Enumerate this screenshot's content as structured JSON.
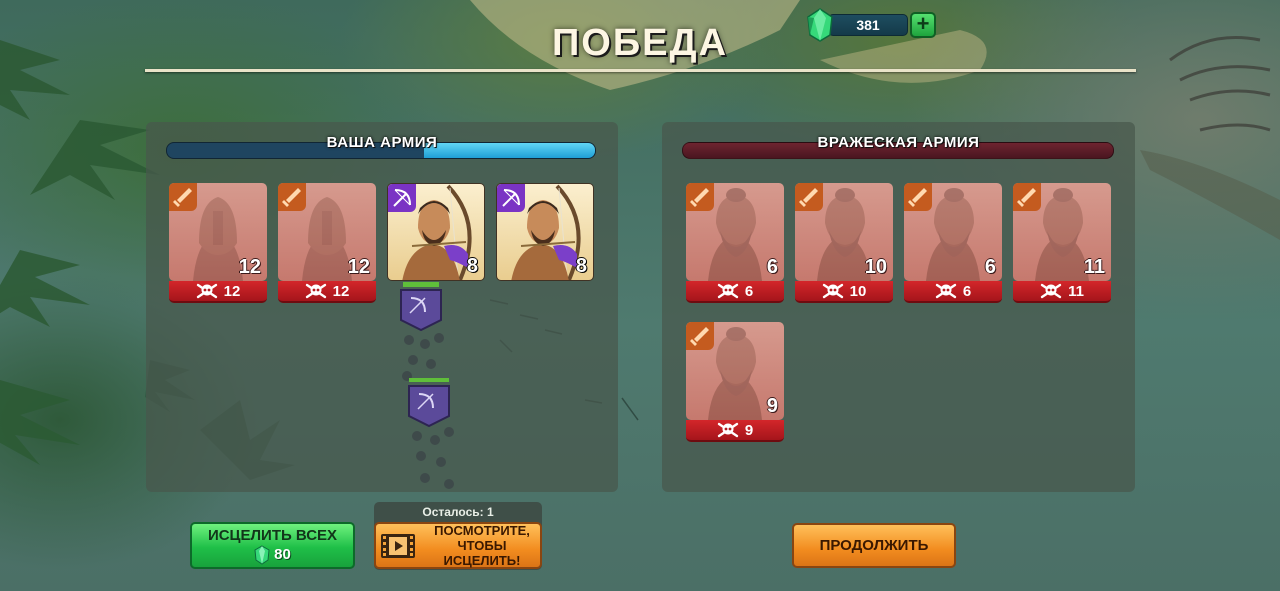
{
  "header": {
    "title": "ПОБЕДА",
    "gems": "381"
  },
  "player_army": {
    "label": "ВАША АРМИЯ",
    "health_fraction": 0.4,
    "units": [
      {
        "type": "sword",
        "count": "12",
        "deaths": "12",
        "status": "dead"
      },
      {
        "type": "sword",
        "count": "12",
        "deaths": "12",
        "status": "dead"
      },
      {
        "type": "bow",
        "count": "8",
        "status": "alive"
      },
      {
        "type": "bow",
        "count": "8",
        "status": "alive"
      }
    ]
  },
  "enemy_army": {
    "label": "ВРАЖЕСКАЯ АРМИЯ",
    "health_fraction": 0,
    "units": [
      {
        "type": "sword",
        "count": "6",
        "deaths": "6",
        "status": "dead"
      },
      {
        "type": "sword",
        "count": "10",
        "deaths": "10",
        "status": "dead"
      },
      {
        "type": "sword",
        "count": "6",
        "deaths": "6",
        "status": "dead"
      },
      {
        "type": "sword",
        "count": "11",
        "deaths": "11",
        "status": "dead"
      },
      {
        "type": "sword",
        "count": "9",
        "deaths": "9",
        "status": "dead"
      }
    ]
  },
  "actions": {
    "heal_all_label": "ИСЦЕЛИТЬ ВСЕХ",
    "heal_all_cost": "80",
    "remaining_label": "Осталось: 1",
    "watch_line1": "ПОСМОТРИТЕ,",
    "watch_line2": "ЧТОБЫ ИСЦЕЛИТЬ!",
    "continue_label": "ПРОДОЛЖИТЬ"
  },
  "icons": {
    "gem": "gem-icon",
    "plus": "plus-icon",
    "sword": "sword-icon",
    "bow": "bow-icon",
    "skull": "skull-crossbones-icon",
    "film": "film-icon"
  },
  "colors": {
    "ally_bar": "#1f9fd6",
    "enemy_bar": "#6e2430",
    "death_strip": "#c51f24",
    "sword_badge": "#c45b1f",
    "bow_badge": "#7a33c4",
    "heal_button": "#1fbf48",
    "orange_button": "#f28c1f"
  }
}
